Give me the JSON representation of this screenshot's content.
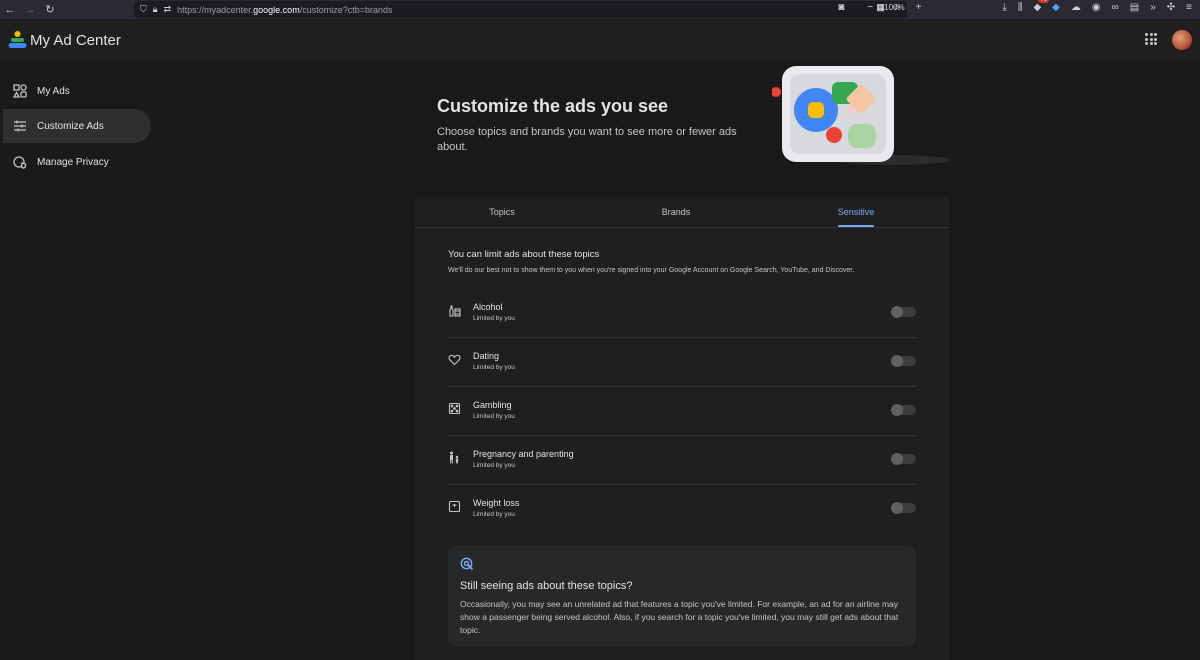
{
  "browser": {
    "url_prefix": "https://myadcenter.",
    "url_host": "google.com",
    "url_suffix": "/customize?ctb=brands",
    "zoom": "100%",
    "extension_badge": "78"
  },
  "header": {
    "app_title": "My Ad Center"
  },
  "sidebar": {
    "items": [
      {
        "label": "My Ads",
        "icon": "my-ads-icon",
        "active": false
      },
      {
        "label": "Customize Ads",
        "icon": "sliders-icon",
        "active": true
      },
      {
        "label": "Manage Privacy",
        "icon": "privacy-icon",
        "active": false
      }
    ]
  },
  "hero": {
    "title": "Customize the ads you see",
    "subtitle": "Choose topics and brands you want to see more or fewer ads about."
  },
  "tabs": [
    {
      "label": "Topics",
      "active": false
    },
    {
      "label": "Brands",
      "active": false
    },
    {
      "label": "Sensitive",
      "active": true
    }
  ],
  "section": {
    "title": "You can limit ads about these topics",
    "description": "We'll do our best not to show them to you when you're signed into your Google Account on Google Search, YouTube, and Discover."
  },
  "topics": [
    {
      "label": "Alcohol",
      "status": "Limited by you",
      "icon": "alcohol-icon",
      "enabled": false
    },
    {
      "label": "Dating",
      "status": "Limited by you",
      "icon": "heart-icon",
      "enabled": false
    },
    {
      "label": "Gambling",
      "status": "Limited by you",
      "icon": "dice-icon",
      "enabled": false
    },
    {
      "label": "Pregnancy and parenting",
      "status": "Limited by you",
      "icon": "parenting-icon",
      "enabled": false
    },
    {
      "label": "Weight loss",
      "status": "Limited by you",
      "icon": "scale-icon",
      "enabled": false
    }
  ],
  "info": {
    "title": "Still seeing ads about these topics?",
    "text": "Occasionally, you may see an unrelated ad that features a topic you've limited. For example, an ad for an airline may show a passenger being served alcohol. Also, if you search for a topic you've limited, you may still get ads about that topic."
  },
  "colors": {
    "accent": "#7cacf8",
    "background": "#1f1f1f",
    "card": "#1e1f20"
  }
}
